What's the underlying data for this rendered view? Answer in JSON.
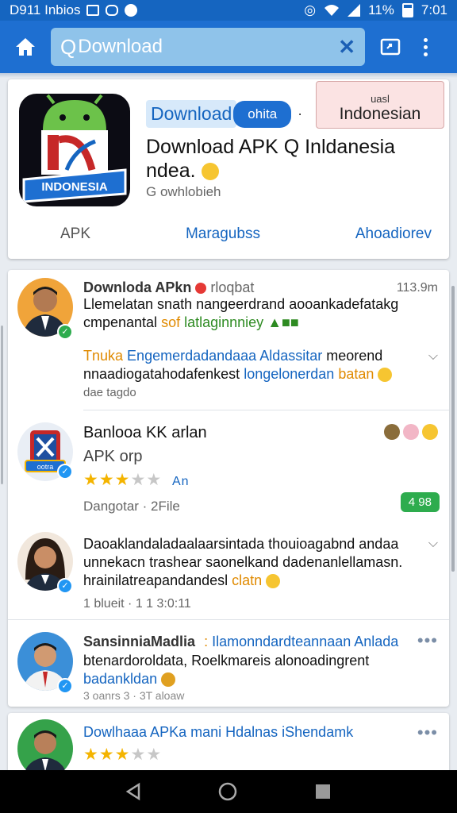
{
  "status_bar": {
    "left_text": "D911 Inbios",
    "signal_text": "11%",
    "time": "7:01"
  },
  "appbar": {
    "search_value": "Download",
    "icons": [
      "home-icon",
      "search-icon",
      "close-icon",
      "share-icon",
      "more-vert-icon"
    ]
  },
  "app_card": {
    "tag_primary": "Download",
    "tag_secondary": "ohita",
    "tag_separator": "·",
    "lang_small": "uasl",
    "lang_big": "Indonesian",
    "title_line1": "Download APK Q Inldanesia",
    "title_line2": "ndea.",
    "subtitle": "G owhlobieh",
    "icon_label": "INDONESIA",
    "tabs": [
      "APK",
      "Maragubss",
      "Ahoadiorev"
    ]
  },
  "feed": {
    "post1": {
      "title": "Downloda APkn",
      "title_extra": "rloqbat",
      "time": "113.9m",
      "line1": "Llemelatan snath nangeerdrand aooankadefatakg",
      "line2_a": "cmpenantal",
      "line2_b": "sof",
      "line2_c": "latlaginnniey",
      "line3_a": "Tnuka",
      "line3_b": "Engemerdadandaaa Aldassitar",
      "line3_c": "meorend",
      "line4_a": "nnaadiogatahodafenkest",
      "line4_b": "longelonerdan",
      "line4_c": "batan",
      "meta": "dae tagdo"
    },
    "post2": {
      "title": "Banlooa KK arlan",
      "subtitle": "APK orp",
      "rating_label": "An",
      "meta": "Dangotar · 2File",
      "badge": "4 98",
      "icon_label": "ootra",
      "rating": 2.5
    },
    "post3": {
      "line1": "Daoaklandaladaalaarsintada thouioagabnd andaa",
      "line2": "unnekacn trashear saonelkand dadenanlellamasn.",
      "line3_a": "hrainilatreapandandesl",
      "line3_b": "clatn",
      "meta": "1 blueit · 1 1 3:0:11"
    },
    "post4": {
      "title": "SansinniaMadlia",
      "title_b": "Ilamonndardteannaan Anlada",
      "line2": "btenardoroldata, Roelkmareis alonoadingrent",
      "line3": "badankldan",
      "meta": "3 oanrs 3 · 3T aloaw"
    }
  },
  "card2": {
    "title": "Dowlhaaa APKa mani Hdalnas iShendamk",
    "rating": 2.5
  },
  "navbar": {
    "icons": [
      "back-icon",
      "home-circle-icon",
      "recents-icon"
    ]
  },
  "colors": {
    "primary": "#1e6fd1",
    "status_bar": "#1565c0",
    "search_bg": "#8fc3ea",
    "accent_green": "#2eac4e",
    "star": "#f4b400"
  }
}
